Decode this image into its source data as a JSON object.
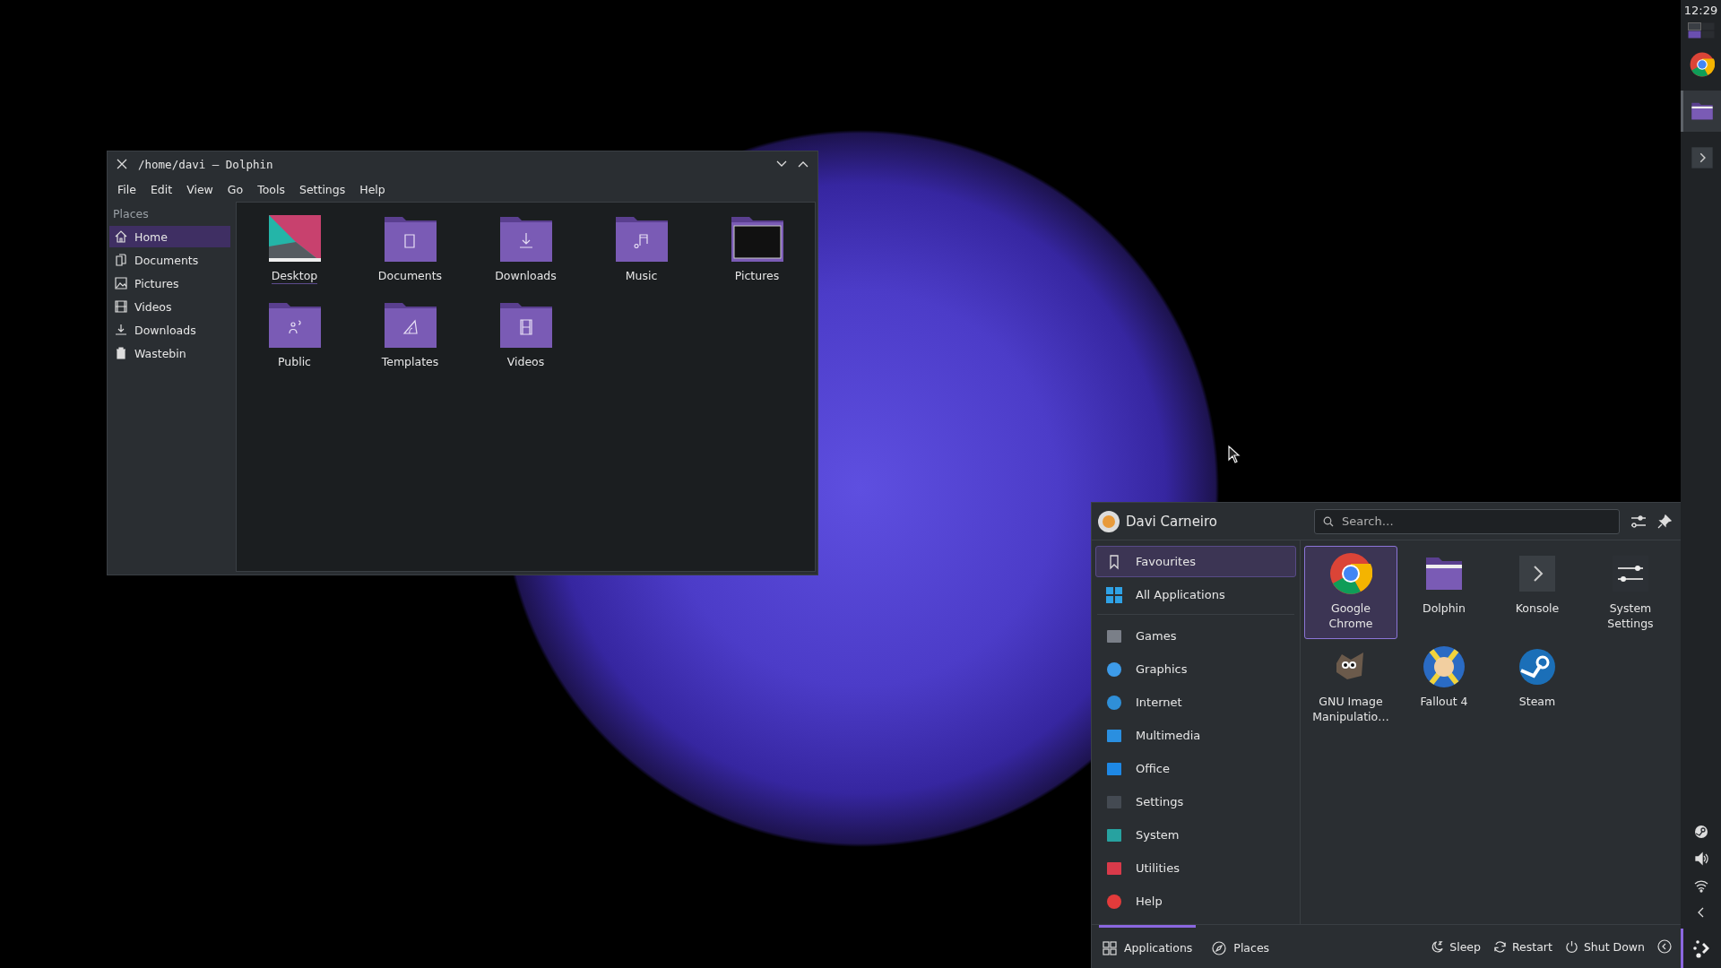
{
  "dolphin": {
    "title": "/home/davi — Dolphin",
    "menu": [
      "File",
      "Edit",
      "View",
      "Go",
      "Tools",
      "Settings",
      "Help"
    ],
    "places_heading": "Places",
    "places": [
      {
        "label": "Home",
        "kind": "home",
        "selected": true
      },
      {
        "label": "Documents",
        "kind": "documents",
        "selected": false
      },
      {
        "label": "Pictures",
        "kind": "pictures",
        "selected": false
      },
      {
        "label": "Videos",
        "kind": "videos",
        "selected": false
      },
      {
        "label": "Downloads",
        "kind": "downloads",
        "selected": false
      },
      {
        "label": "Wastebin",
        "kind": "trash",
        "selected": false
      }
    ],
    "items": [
      {
        "label": "Desktop",
        "kind": "desktop",
        "focused": true
      },
      {
        "label": "Documents",
        "kind": "documents",
        "focused": false
      },
      {
        "label": "Downloads",
        "kind": "downloads",
        "focused": false
      },
      {
        "label": "Music",
        "kind": "music",
        "focused": false
      },
      {
        "label": "Pictures",
        "kind": "pictures",
        "focused": false
      },
      {
        "label": "Public",
        "kind": "public",
        "focused": false
      },
      {
        "label": "Templates",
        "kind": "templates",
        "focused": false
      },
      {
        "label": "Videos",
        "kind": "videos",
        "focused": false
      }
    ]
  },
  "launcher": {
    "user": "Davi Carneiro",
    "search": {
      "placeholder": "Search…"
    },
    "categories": [
      {
        "label": "Favourites",
        "kind": "favourites",
        "selected": true
      },
      {
        "label": "All Applications",
        "kind": "all",
        "selected": false
      },
      {
        "label": "Games",
        "kind": "games",
        "selected": false
      },
      {
        "label": "Graphics",
        "kind": "graphics",
        "selected": false
      },
      {
        "label": "Internet",
        "kind": "internet",
        "selected": false
      },
      {
        "label": "Multimedia",
        "kind": "multimedia",
        "selected": false
      },
      {
        "label": "Office",
        "kind": "office",
        "selected": false
      },
      {
        "label": "Settings",
        "kind": "settings",
        "selected": false
      },
      {
        "label": "System",
        "kind": "system",
        "selected": false
      },
      {
        "label": "Utilities",
        "kind": "utilities",
        "selected": false
      },
      {
        "label": "Help",
        "kind": "help",
        "selected": false
      }
    ],
    "apps": [
      {
        "label": "Google Chrome",
        "kind": "chrome",
        "selected": true
      },
      {
        "label": "Dolphin",
        "kind": "folder",
        "selected": false
      },
      {
        "label": "Konsole",
        "kind": "terminal",
        "selected": false
      },
      {
        "label": "System Settings",
        "kind": "settings",
        "selected": false
      },
      {
        "label": "GNU Image Manipulatio…",
        "kind": "gimp",
        "selected": false
      },
      {
        "label": "Fallout 4",
        "kind": "fallout",
        "selected": false
      },
      {
        "label": "Steam",
        "kind": "steam",
        "selected": false
      }
    ],
    "tabs": [
      {
        "label": "Applications",
        "kind": "grid",
        "selected": true
      },
      {
        "label": "Places",
        "kind": "compass",
        "selected": false
      }
    ],
    "actions": [
      {
        "label": "Sleep",
        "kind": "sleep"
      },
      {
        "label": "Restart",
        "kind": "restart"
      },
      {
        "label": "Shut Down",
        "kind": "shutdown"
      }
    ]
  },
  "panel": {
    "clock": "12:29",
    "tasks": [
      {
        "kind": "chrome",
        "active": false
      },
      {
        "kind": "folder",
        "active": true
      },
      {
        "kind": "terminal",
        "active": false
      }
    ],
    "tray": [
      {
        "kind": "steam"
      },
      {
        "kind": "volume"
      },
      {
        "kind": "wifi"
      },
      {
        "kind": "chevron"
      }
    ],
    "launcher_open": true
  }
}
